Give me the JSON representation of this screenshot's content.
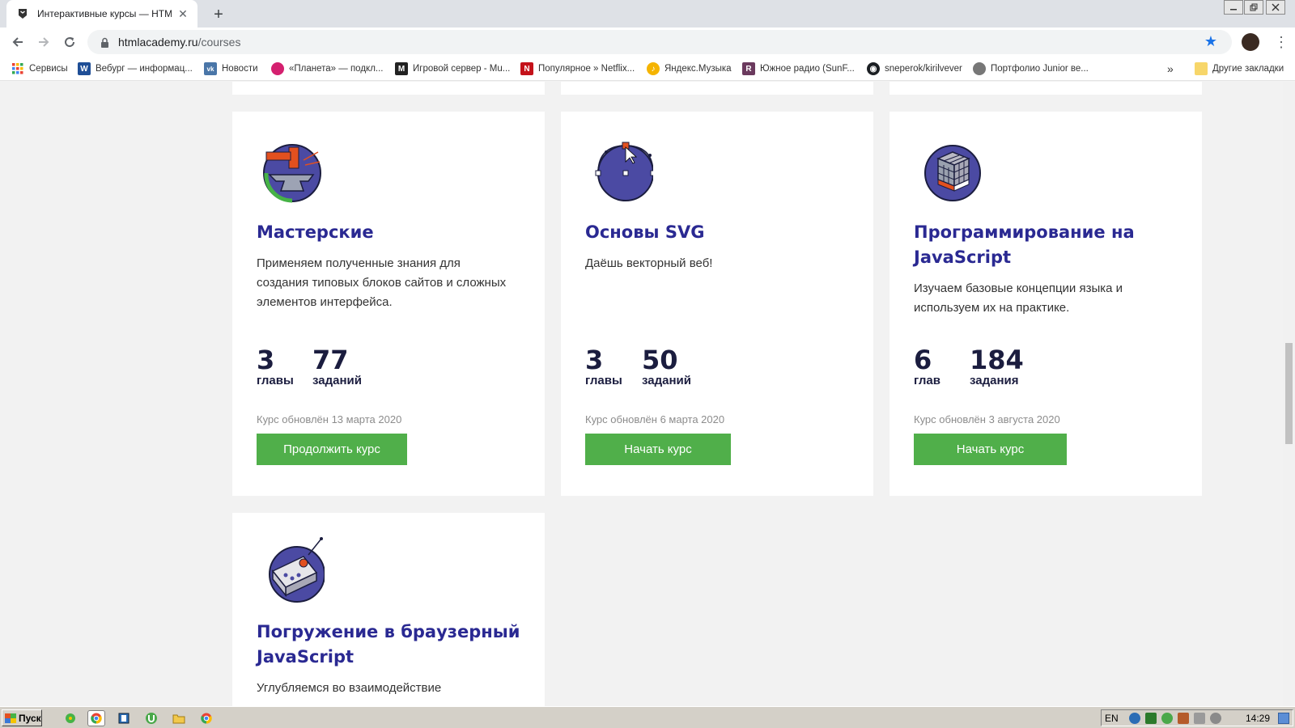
{
  "browser": {
    "tab_title": "Интерактивные курсы — HTML Academy",
    "tab_close": "✕",
    "new_tab": "+",
    "url_host": "htmlacademy.ru",
    "url_path": "/courses",
    "bookmarks": [
      {
        "label": "Сервисы",
        "icon": "apps-grid-icon",
        "color": "#e94235"
      },
      {
        "label": "Вебург — информац...",
        "icon": "w-logo-icon",
        "color": "#1f4e96"
      },
      {
        "label": "Новости",
        "icon": "vk-icon",
        "color": "#4a76a8"
      },
      {
        "label": "«Планета» — подкл...",
        "icon": "planeta-icon",
        "color": "#d4206f"
      },
      {
        "label": "Игровой сервер - Mu...",
        "icon": "mu-icon",
        "color": "#222222"
      },
      {
        "label": "Популярное » Netflix...",
        "icon": "netflix-icon",
        "color": "#c4121a"
      },
      {
        "label": "Яндекс.Музыка",
        "icon": "yandex-music-icon",
        "color": "#f5b400"
      },
      {
        "label": "Южное радио (SunF...",
        "icon": "radio-icon",
        "color": "#6b3a5e"
      },
      {
        "label": "sneperok/kirilvever",
        "icon": "github-icon",
        "color": "#1b1f23"
      },
      {
        "label": "Портфолио Junior ве...",
        "icon": "globe-icon",
        "color": "#555555"
      }
    ],
    "more_bookmarks": "»",
    "other_bookmarks": "Другие закладки"
  },
  "courses": [
    {
      "title": "Мастерские",
      "description": "Применяем полученные знания для создания типовых блоков сайтов и сложных элементов интерфейса.",
      "chapters_num": "3",
      "chapters_label": "главы",
      "tasks_num": "77",
      "tasks_label": "заданий",
      "updated": "Курс обновлён 13 марта 2020",
      "button": "Продолжить курс",
      "icon": "anvil-icon"
    },
    {
      "title": "Основы SVG",
      "description": "Даёшь векторный веб!",
      "chapters_num": "3",
      "chapters_label": "главы",
      "tasks_num": "50",
      "tasks_label": "заданий",
      "updated": "Курс обновлён 6 марта 2020",
      "button": "Начать курс",
      "icon": "vector-circle-icon"
    },
    {
      "title": "Программирование на JavaScript",
      "description": "Изучаем базовые концепции языка и используем их на практике.",
      "chapters_num": "6",
      "chapters_label": "глав",
      "tasks_num": "184",
      "tasks_label": "задания",
      "updated": "Курс обновлён 3 августа 2020",
      "button": "Начать курс",
      "icon": "rubiks-cube-icon"
    },
    {
      "title": "Погружение в браузерный JavaScript",
      "description": "Углубляемся во взаимодействие",
      "icon": "remote-control-icon"
    }
  ],
  "taskbar": {
    "start_label": "Пуск",
    "lang": "EN",
    "clock": "14:29"
  },
  "colors": {
    "title": "#2a2992",
    "button": "#50af4a",
    "icon_circle": "#4b4aa3"
  }
}
